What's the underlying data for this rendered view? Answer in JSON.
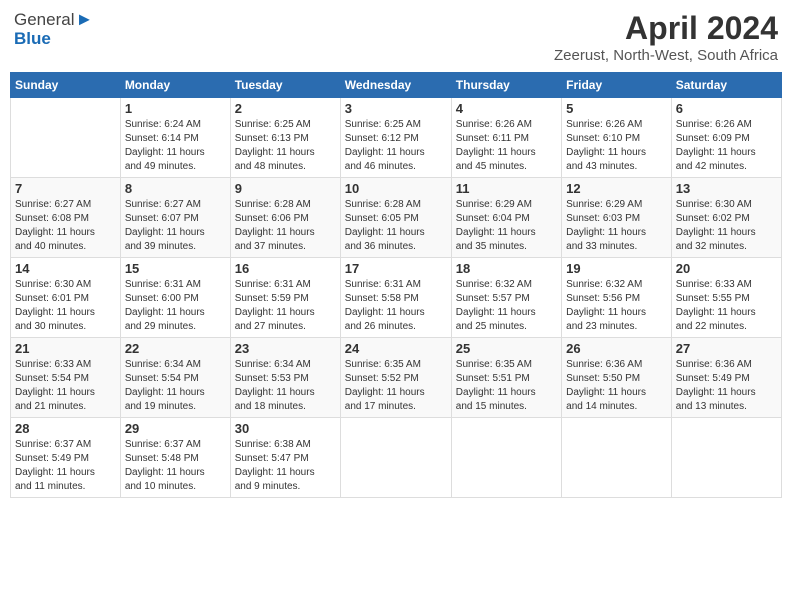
{
  "header": {
    "logo_general": "General",
    "logo_blue": "Blue",
    "title": "April 2024",
    "subtitle": "Zeerust, North-West, South Africa"
  },
  "weekdays": [
    "Sunday",
    "Monday",
    "Tuesday",
    "Wednesday",
    "Thursday",
    "Friday",
    "Saturday"
  ],
  "weeks": [
    [
      {
        "num": "",
        "info": ""
      },
      {
        "num": "1",
        "info": "Sunrise: 6:24 AM\nSunset: 6:14 PM\nDaylight: 11 hours\nand 49 minutes."
      },
      {
        "num": "2",
        "info": "Sunrise: 6:25 AM\nSunset: 6:13 PM\nDaylight: 11 hours\nand 48 minutes."
      },
      {
        "num": "3",
        "info": "Sunrise: 6:25 AM\nSunset: 6:12 PM\nDaylight: 11 hours\nand 46 minutes."
      },
      {
        "num": "4",
        "info": "Sunrise: 6:26 AM\nSunset: 6:11 PM\nDaylight: 11 hours\nand 45 minutes."
      },
      {
        "num": "5",
        "info": "Sunrise: 6:26 AM\nSunset: 6:10 PM\nDaylight: 11 hours\nand 43 minutes."
      },
      {
        "num": "6",
        "info": "Sunrise: 6:26 AM\nSunset: 6:09 PM\nDaylight: 11 hours\nand 42 minutes."
      }
    ],
    [
      {
        "num": "7",
        "info": "Sunrise: 6:27 AM\nSunset: 6:08 PM\nDaylight: 11 hours\nand 40 minutes."
      },
      {
        "num": "8",
        "info": "Sunrise: 6:27 AM\nSunset: 6:07 PM\nDaylight: 11 hours\nand 39 minutes."
      },
      {
        "num": "9",
        "info": "Sunrise: 6:28 AM\nSunset: 6:06 PM\nDaylight: 11 hours\nand 37 minutes."
      },
      {
        "num": "10",
        "info": "Sunrise: 6:28 AM\nSunset: 6:05 PM\nDaylight: 11 hours\nand 36 minutes."
      },
      {
        "num": "11",
        "info": "Sunrise: 6:29 AM\nSunset: 6:04 PM\nDaylight: 11 hours\nand 35 minutes."
      },
      {
        "num": "12",
        "info": "Sunrise: 6:29 AM\nSunset: 6:03 PM\nDaylight: 11 hours\nand 33 minutes."
      },
      {
        "num": "13",
        "info": "Sunrise: 6:30 AM\nSunset: 6:02 PM\nDaylight: 11 hours\nand 32 minutes."
      }
    ],
    [
      {
        "num": "14",
        "info": "Sunrise: 6:30 AM\nSunset: 6:01 PM\nDaylight: 11 hours\nand 30 minutes."
      },
      {
        "num": "15",
        "info": "Sunrise: 6:31 AM\nSunset: 6:00 PM\nDaylight: 11 hours\nand 29 minutes."
      },
      {
        "num": "16",
        "info": "Sunrise: 6:31 AM\nSunset: 5:59 PM\nDaylight: 11 hours\nand 27 minutes."
      },
      {
        "num": "17",
        "info": "Sunrise: 6:31 AM\nSunset: 5:58 PM\nDaylight: 11 hours\nand 26 minutes."
      },
      {
        "num": "18",
        "info": "Sunrise: 6:32 AM\nSunset: 5:57 PM\nDaylight: 11 hours\nand 25 minutes."
      },
      {
        "num": "19",
        "info": "Sunrise: 6:32 AM\nSunset: 5:56 PM\nDaylight: 11 hours\nand 23 minutes."
      },
      {
        "num": "20",
        "info": "Sunrise: 6:33 AM\nSunset: 5:55 PM\nDaylight: 11 hours\nand 22 minutes."
      }
    ],
    [
      {
        "num": "21",
        "info": "Sunrise: 6:33 AM\nSunset: 5:54 PM\nDaylight: 11 hours\nand 21 minutes."
      },
      {
        "num": "22",
        "info": "Sunrise: 6:34 AM\nSunset: 5:54 PM\nDaylight: 11 hours\nand 19 minutes."
      },
      {
        "num": "23",
        "info": "Sunrise: 6:34 AM\nSunset: 5:53 PM\nDaylight: 11 hours\nand 18 minutes."
      },
      {
        "num": "24",
        "info": "Sunrise: 6:35 AM\nSunset: 5:52 PM\nDaylight: 11 hours\nand 17 minutes."
      },
      {
        "num": "25",
        "info": "Sunrise: 6:35 AM\nSunset: 5:51 PM\nDaylight: 11 hours\nand 15 minutes."
      },
      {
        "num": "26",
        "info": "Sunrise: 6:36 AM\nSunset: 5:50 PM\nDaylight: 11 hours\nand 14 minutes."
      },
      {
        "num": "27",
        "info": "Sunrise: 6:36 AM\nSunset: 5:49 PM\nDaylight: 11 hours\nand 13 minutes."
      }
    ],
    [
      {
        "num": "28",
        "info": "Sunrise: 6:37 AM\nSunset: 5:49 PM\nDaylight: 11 hours\nand 11 minutes."
      },
      {
        "num": "29",
        "info": "Sunrise: 6:37 AM\nSunset: 5:48 PM\nDaylight: 11 hours\nand 10 minutes."
      },
      {
        "num": "30",
        "info": "Sunrise: 6:38 AM\nSunset: 5:47 PM\nDaylight: 11 hours\nand 9 minutes."
      },
      {
        "num": "",
        "info": ""
      },
      {
        "num": "",
        "info": ""
      },
      {
        "num": "",
        "info": ""
      },
      {
        "num": "",
        "info": ""
      }
    ]
  ]
}
